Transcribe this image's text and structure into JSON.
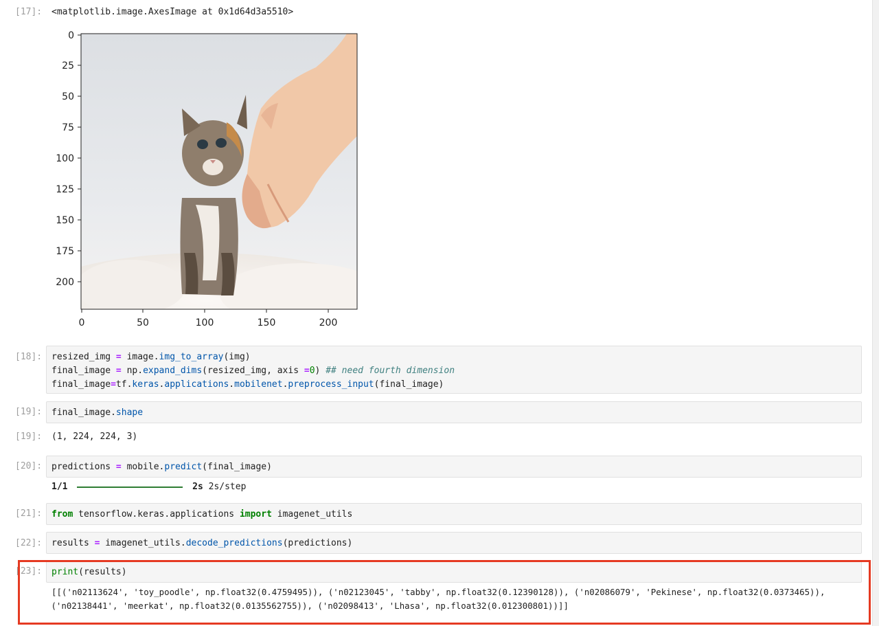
{
  "cell17": {
    "prompt": "[17]:",
    "output_text": "<matplotlib.image.AxesImage at 0x1d64d3a5510>",
    "plot": {
      "y_ticks": [
        "0",
        "25",
        "50",
        "75",
        "100",
        "125",
        "150",
        "175",
        "200"
      ],
      "x_ticks": [
        "0",
        "50",
        "100",
        "150",
        "200"
      ],
      "image_content": "kitten-with-hand-photo"
    }
  },
  "cell18": {
    "prompt": "[18]:",
    "line1": {
      "a": "resized_img ",
      "eq": "=",
      "b": " image.",
      "fn": "img_to_array",
      "c": "(img)"
    },
    "line2": {
      "a": "final_image ",
      "eq": "=",
      "b": " np.",
      "fn": "expand_dims",
      "c": "(resized_img, axis ",
      "eq2": "=",
      "num": "0",
      "d": ") ",
      "comment": "## need fourth dimension"
    },
    "line3": {
      "a": "final_image",
      "eq": "=",
      "b": "tf.",
      "m1": "keras",
      "dot1": ".",
      "m2": "applications",
      "dot2": ".",
      "m3": "mobilenet",
      "dot3": ".",
      "fn": "preprocess_input",
      "c": "(final_image)"
    }
  },
  "cell19": {
    "prompt_in": "[19]:",
    "code": {
      "a": "final_image.",
      "attr": "shape"
    },
    "prompt_out": "[19]:",
    "output": "(1, 224, 224, 3)"
  },
  "cell20": {
    "prompt": "[20]:",
    "code": {
      "a": "predictions ",
      "eq": "=",
      "b": " mobile.",
      "fn": "predict",
      "c": "(final_image)"
    },
    "progress": {
      "step": "1/1",
      "time": "2s",
      "rate": "2s/step",
      "fraction": 1.0
    }
  },
  "cell21": {
    "prompt": "[21]:",
    "code": {
      "kw1": "from",
      "a": " tensorflow.keras.applications ",
      "kw2": "import",
      "b": " imagenet_utils"
    }
  },
  "cell22": {
    "prompt": "[22]:",
    "code": {
      "a": "results ",
      "eq": "=",
      "b": " imagenet_utils.",
      "fn": "decode_predictions",
      "c": "(predictions)"
    }
  },
  "cell23": {
    "prompt": "[23]:",
    "code": {
      "fn": "print",
      "c": "(results)"
    },
    "output_line1": "[[('n02113624', 'toy_poodle', np.float32(0.4759495)), ('n02123045', 'tabby', np.float32(0.12390128)), ('n02086079', 'Pekinese', np.float32(0.0373465)),",
    "output_line2": " ('n02138441', 'meerkat', np.float32(0.0135562755)), ('n02098413', 'Lhasa', np.float32(0.012300801))]]",
    "highlight_color": "#e53a22"
  }
}
